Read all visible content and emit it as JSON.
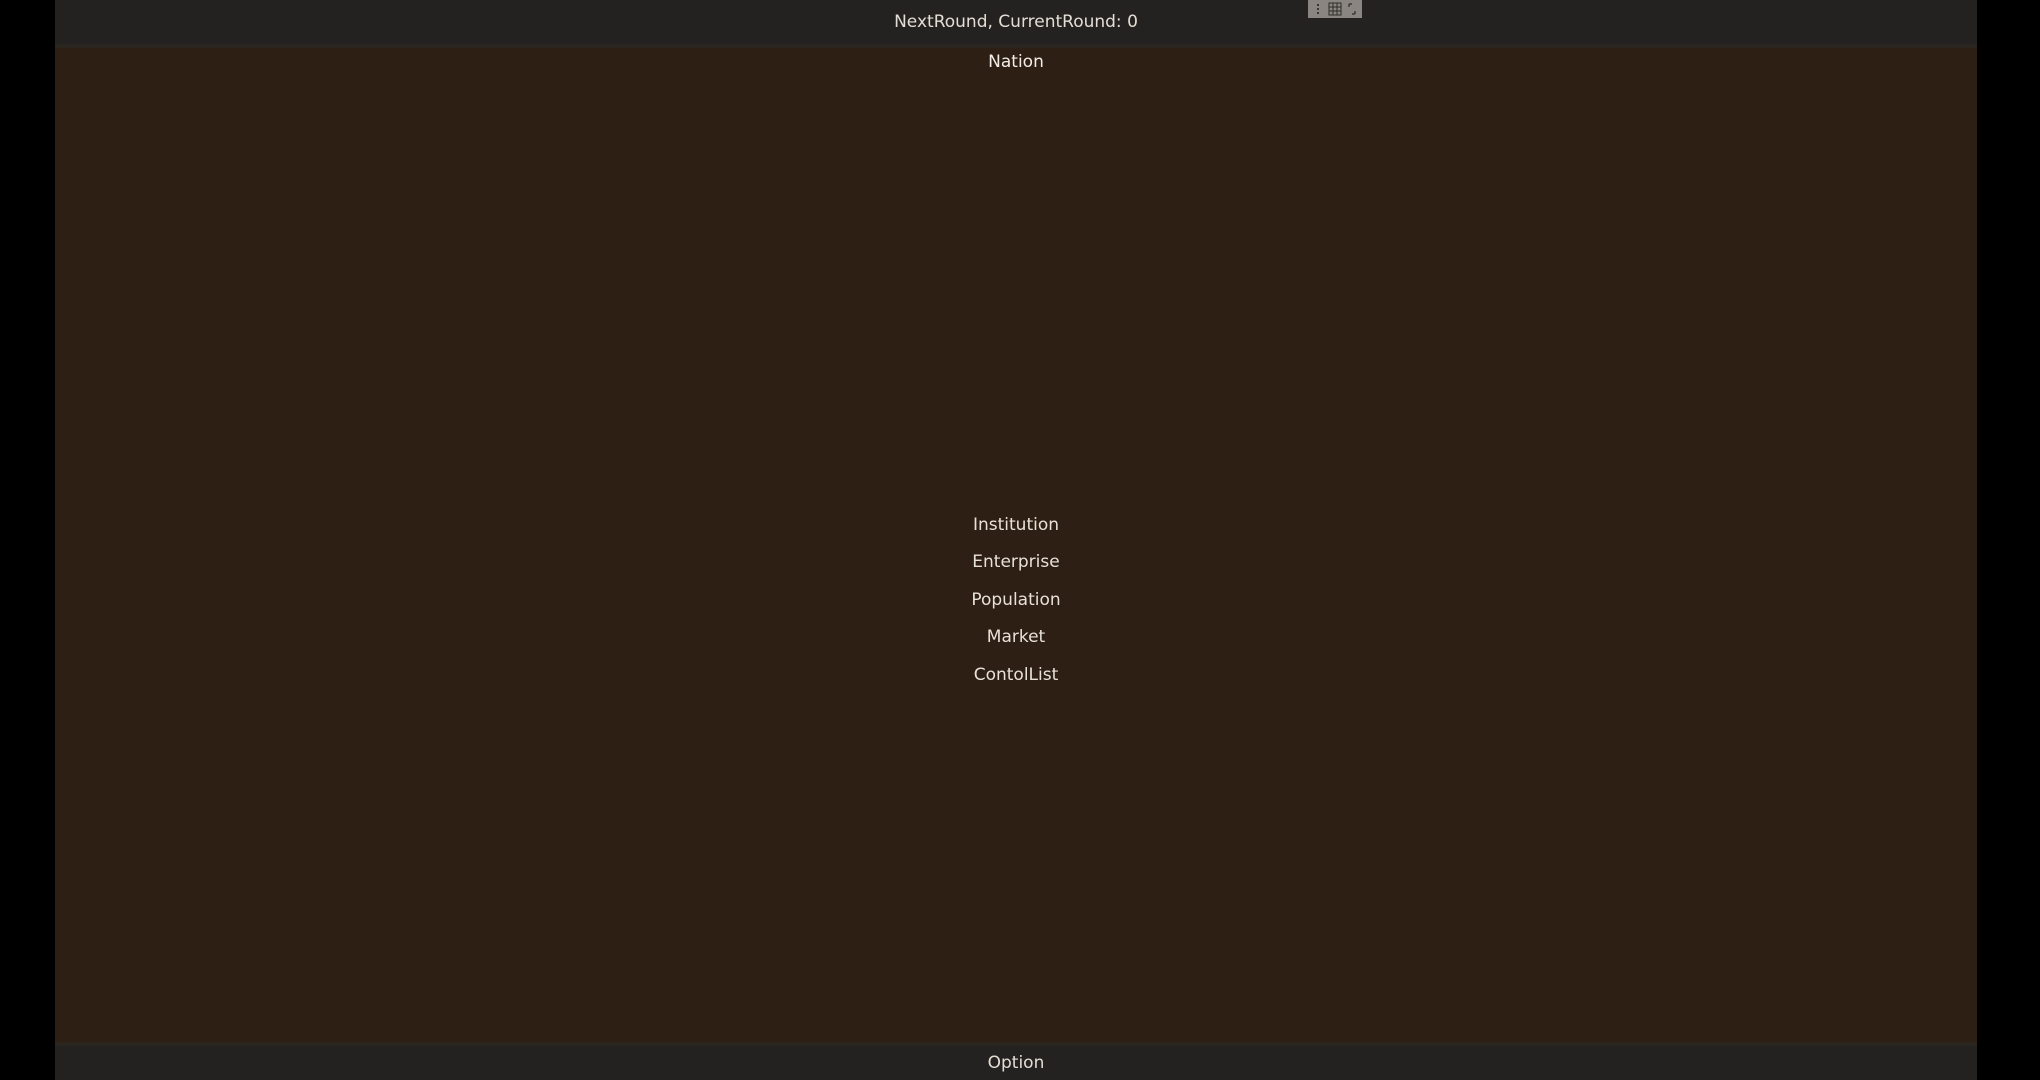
{
  "top_bar": {
    "next_round_label": "NextRound, CurrentRound: 0"
  },
  "editor_toolbar": {
    "icons": [
      "drag-handle-icon",
      "grid-icon",
      "resize-icon"
    ]
  },
  "panel": {
    "title": "Nation",
    "menu_items": [
      {
        "label": "Institution"
      },
      {
        "label": "Enterprise"
      },
      {
        "label": "Population"
      },
      {
        "label": "Market"
      },
      {
        "label": "ContolList"
      }
    ]
  },
  "bottom_bar": {
    "option_label": "Option"
  },
  "colors": {
    "background": "#2d1f13",
    "bar": "#242220",
    "text": "#e8e1d8",
    "letterbox": "#000000"
  }
}
